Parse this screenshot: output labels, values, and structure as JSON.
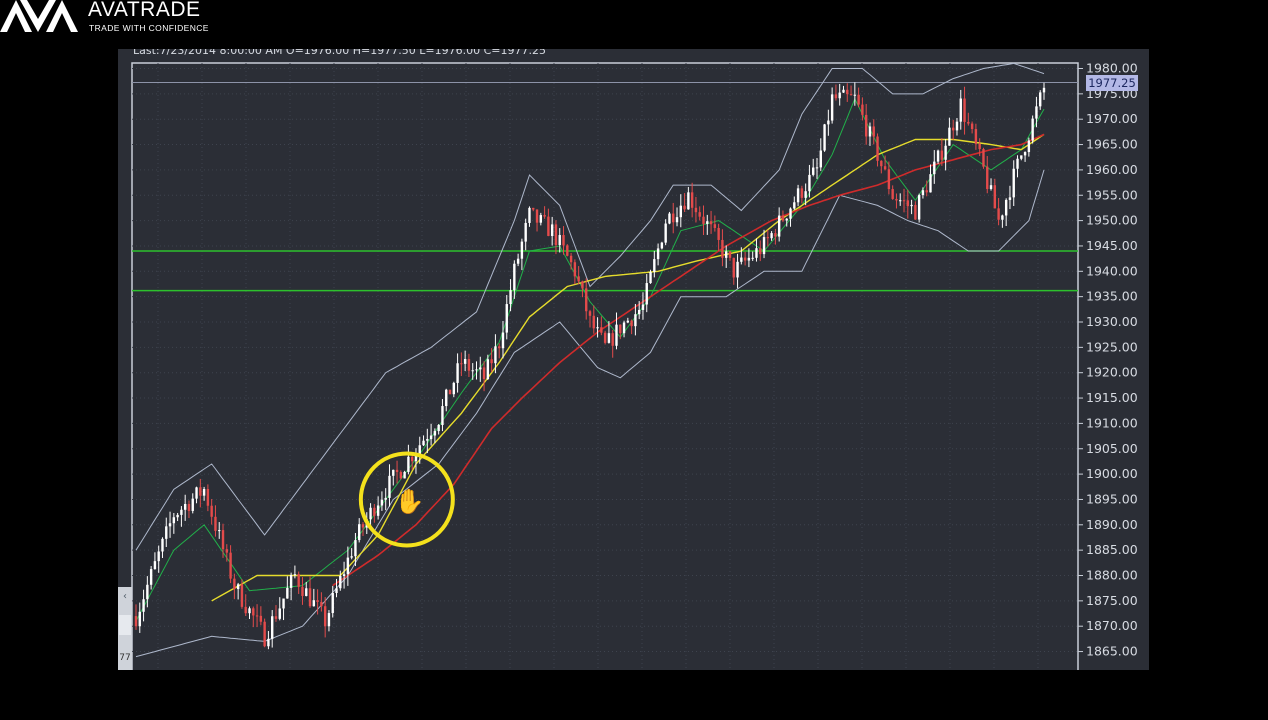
{
  "brand": {
    "name": "AVATRADE",
    "tagline": "TRADE WITH CONFIDENCE"
  },
  "colors": {
    "background": "#000000",
    "chart_background": "#2b2e36",
    "grid": "#3e434e",
    "bull_candle": "#ffffff",
    "bear_candle": "#e44b4b",
    "bollinger": "#aeb8cc",
    "fast_ma": "#21b04a",
    "medium_ma": "#e6dc2c",
    "slow_ma": "#cf2b2b",
    "support_lines": "#2dc12d",
    "highlight_circle": "#f4e11c",
    "last_price_label_bg": "#b3b8e6"
  },
  "chart": {
    "ohlc_info": "Last:7/23/2014 8:00:00 AM O=1976.00 H=1977.50 L=1976.00 C=1977.25",
    "last_price_label": "1977.25",
    "side_tab_label": "77",
    "side_tab_arrow": "‹"
  },
  "chart_data": {
    "type": "candlestick",
    "y_axis": {
      "position": "right",
      "ticks": [
        1980.0,
        1975.0,
        1970.0,
        1965.0,
        1960.0,
        1955.0,
        1950.0,
        1945.0,
        1940.0,
        1935.0,
        1930.0,
        1925.0,
        1920.0,
        1915.0,
        1910.0,
        1905.0,
        1900.0,
        1895.0,
        1890.0,
        1885.0,
        1880.0,
        1875.0,
        1870.0,
        1865.0
      ],
      "tick_labels": [
        "1980.00",
        "1975.00",
        "1970.00",
        "1965.00",
        "1960.00",
        "1955.00",
        "1950.00",
        "1945.00",
        "1940.00",
        "1935.00",
        "1930.00",
        "1925.00",
        "1920.00",
        "1915.00",
        "1910.00",
        "1905.00",
        "1900.00",
        "1895.00",
        "1890.00",
        "1885.00",
        "1880.00",
        "1875.00",
        "1870.00",
        "1865.00"
      ],
      "range": [
        1862.2,
        1983.0
      ]
    },
    "grid": true,
    "horizontal_lines": [
      1944.0,
      1936.2
    ],
    "close_path": [
      [
        0,
        1872
      ],
      [
        10,
        1892
      ],
      [
        18,
        1897
      ],
      [
        26,
        1878
      ],
      [
        34,
        1868
      ],
      [
        42,
        1880
      ],
      [
        50,
        1871
      ],
      [
        58,
        1887
      ],
      [
        64,
        1895
      ],
      [
        72,
        1903
      ],
      [
        80,
        1911
      ],
      [
        86,
        1922
      ],
      [
        92,
        1919
      ],
      [
        96,
        1926
      ],
      [
        100,
        1940
      ],
      [
        104,
        1951
      ],
      [
        110,
        1948
      ],
      [
        116,
        1940
      ],
      [
        120,
        1930
      ],
      [
        124,
        1925
      ],
      [
        128,
        1929
      ],
      [
        134,
        1933
      ],
      [
        140,
        1950
      ],
      [
        146,
        1955
      ],
      [
        152,
        1948
      ],
      [
        158,
        1940
      ],
      [
        166,
        1945
      ],
      [
        174,
        1954
      ],
      [
        180,
        1960
      ],
      [
        184,
        1974
      ],
      [
        190,
        1974
      ],
      [
        196,
        1963
      ],
      [
        200,
        1955
      ],
      [
        206,
        1952
      ],
      [
        212,
        1962
      ],
      [
        218,
        1973
      ],
      [
        224,
        1960
      ],
      [
        228,
        1950
      ],
      [
        234,
        1963
      ],
      [
        240,
        1976
      ]
    ],
    "series": [
      {
        "kind": "bollinger_upper",
        "points": [
          [
            0,
            1885
          ],
          [
            10,
            1897
          ],
          [
            20,
            1902
          ],
          [
            34,
            1888
          ],
          [
            46,
            1900
          ],
          [
            56,
            1910
          ],
          [
            66,
            1920
          ],
          [
            78,
            1925
          ],
          [
            90,
            1932
          ],
          [
            100,
            1950
          ],
          [
            104,
            1959
          ],
          [
            112,
            1953
          ],
          [
            120,
            1937
          ],
          [
            128,
            1943
          ],
          [
            136,
            1950
          ],
          [
            142,
            1957
          ],
          [
            152,
            1957
          ],
          [
            160,
            1952
          ],
          [
            170,
            1960
          ],
          [
            176,
            1971
          ],
          [
            184,
            1980
          ],
          [
            192,
            1980
          ],
          [
            200,
            1975
          ],
          [
            208,
            1975
          ],
          [
            216,
            1978
          ],
          [
            224,
            1980
          ],
          [
            232,
            1981
          ],
          [
            240,
            1979
          ]
        ]
      },
      {
        "kind": "bollinger_lower",
        "points": [
          [
            0,
            1864
          ],
          [
            20,
            1868
          ],
          [
            34,
            1867
          ],
          [
            44,
            1870
          ],
          [
            56,
            1880
          ],
          [
            68,
            1895
          ],
          [
            80,
            1902
          ],
          [
            90,
            1912
          ],
          [
            100,
            1924
          ],
          [
            112,
            1930
          ],
          [
            122,
            1921
          ],
          [
            128,
            1919
          ],
          [
            136,
            1924
          ],
          [
            144,
            1935
          ],
          [
            156,
            1935
          ],
          [
            166,
            1940
          ],
          [
            176,
            1940
          ],
          [
            186,
            1955
          ],
          [
            196,
            1953
          ],
          [
            204,
            1950
          ],
          [
            212,
            1948
          ],
          [
            220,
            1944
          ],
          [
            228,
            1944
          ],
          [
            236,
            1950
          ],
          [
            240,
            1960
          ]
        ]
      },
      {
        "kind": "fast_ma",
        "points": [
          [
            0,
            1871
          ],
          [
            10,
            1885
          ],
          [
            18,
            1890
          ],
          [
            30,
            1877
          ],
          [
            44,
            1878
          ],
          [
            56,
            1885
          ],
          [
            66,
            1895
          ],
          [
            76,
            1905
          ],
          [
            86,
            1916
          ],
          [
            96,
            1926
          ],
          [
            104,
            1944
          ],
          [
            112,
            1945
          ],
          [
            120,
            1934
          ],
          [
            128,
            1927
          ],
          [
            136,
            1935
          ],
          [
            144,
            1948
          ],
          [
            154,
            1950
          ],
          [
            166,
            1944
          ],
          [
            176,
            1953
          ],
          [
            184,
            1963
          ],
          [
            190,
            1974
          ],
          [
            198,
            1962
          ],
          [
            206,
            1954
          ],
          [
            216,
            1965
          ],
          [
            226,
            1960
          ],
          [
            234,
            1964
          ],
          [
            240,
            1972
          ]
        ]
      },
      {
        "kind": "medium_ma",
        "points": [
          [
            20,
            1875
          ],
          [
            32,
            1880
          ],
          [
            44,
            1880
          ],
          [
            54,
            1880
          ],
          [
            64,
            1888
          ],
          [
            74,
            1902
          ],
          [
            86,
            1912
          ],
          [
            96,
            1922
          ],
          [
            104,
            1931
          ],
          [
            114,
            1937
          ],
          [
            124,
            1939
          ],
          [
            138,
            1940
          ],
          [
            148,
            1942
          ],
          [
            160,
            1944
          ],
          [
            170,
            1950
          ],
          [
            178,
            1954
          ],
          [
            186,
            1958
          ],
          [
            196,
            1963
          ],
          [
            206,
            1966
          ],
          [
            216,
            1966
          ],
          [
            226,
            1965
          ],
          [
            234,
            1964
          ],
          [
            240,
            1967
          ]
        ]
      },
      {
        "kind": "slow_ma",
        "points": [
          [
            52,
            1878
          ],
          [
            64,
            1884
          ],
          [
            74,
            1890
          ],
          [
            84,
            1898
          ],
          [
            94,
            1909
          ],
          [
            102,
            1915
          ],
          [
            112,
            1922
          ],
          [
            122,
            1928
          ],
          [
            132,
            1933
          ],
          [
            144,
            1939
          ],
          [
            156,
            1945
          ],
          [
            168,
            1950
          ],
          [
            178,
            1953
          ],
          [
            186,
            1955
          ],
          [
            196,
            1957
          ],
          [
            206,
            1960
          ],
          [
            216,
            1962
          ],
          [
            226,
            1964
          ],
          [
            234,
            1965
          ],
          [
            240,
            1967
          ]
        ]
      }
    ],
    "annotation": {
      "kind": "highlight-circle-with-hand-cursor",
      "x": 70,
      "y": 1895
    }
  }
}
